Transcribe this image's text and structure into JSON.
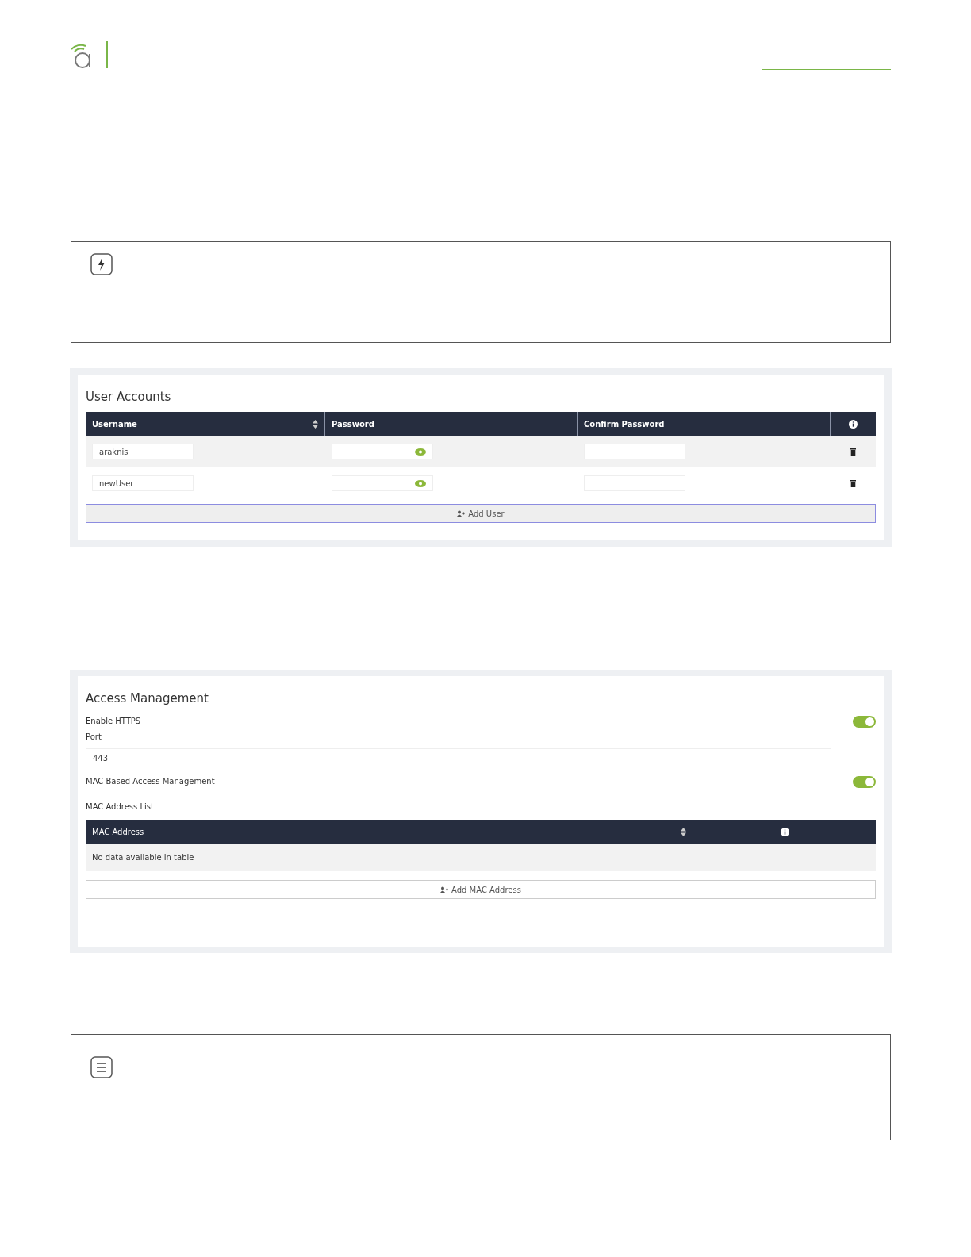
{
  "callouts": [
    {
      "kind": "bolt"
    },
    {
      "kind": "list"
    }
  ],
  "user_accounts": {
    "title": "User Accounts",
    "columns": [
      {
        "label": "Username",
        "sortable": true
      },
      {
        "label": "Password",
        "sortable": false
      },
      {
        "label": "Confirm Password",
        "sortable": false
      }
    ],
    "rows": [
      {
        "username": "araknis"
      },
      {
        "username": "newUser"
      }
    ],
    "add_button": "Add User"
  },
  "access_management": {
    "title": "Access Management",
    "https": {
      "label": "Enable HTTPS",
      "on": true
    },
    "port": {
      "label": "Port",
      "value": "443"
    },
    "mac_access": {
      "label": "MAC Based Access Management",
      "on": true
    },
    "mac_list": {
      "label": "MAC Address List",
      "columns": [
        {
          "label": "MAC Address",
          "sortable": true
        }
      ],
      "empty_message": "No data available in table",
      "add_button": "Add MAC Address"
    }
  }
}
